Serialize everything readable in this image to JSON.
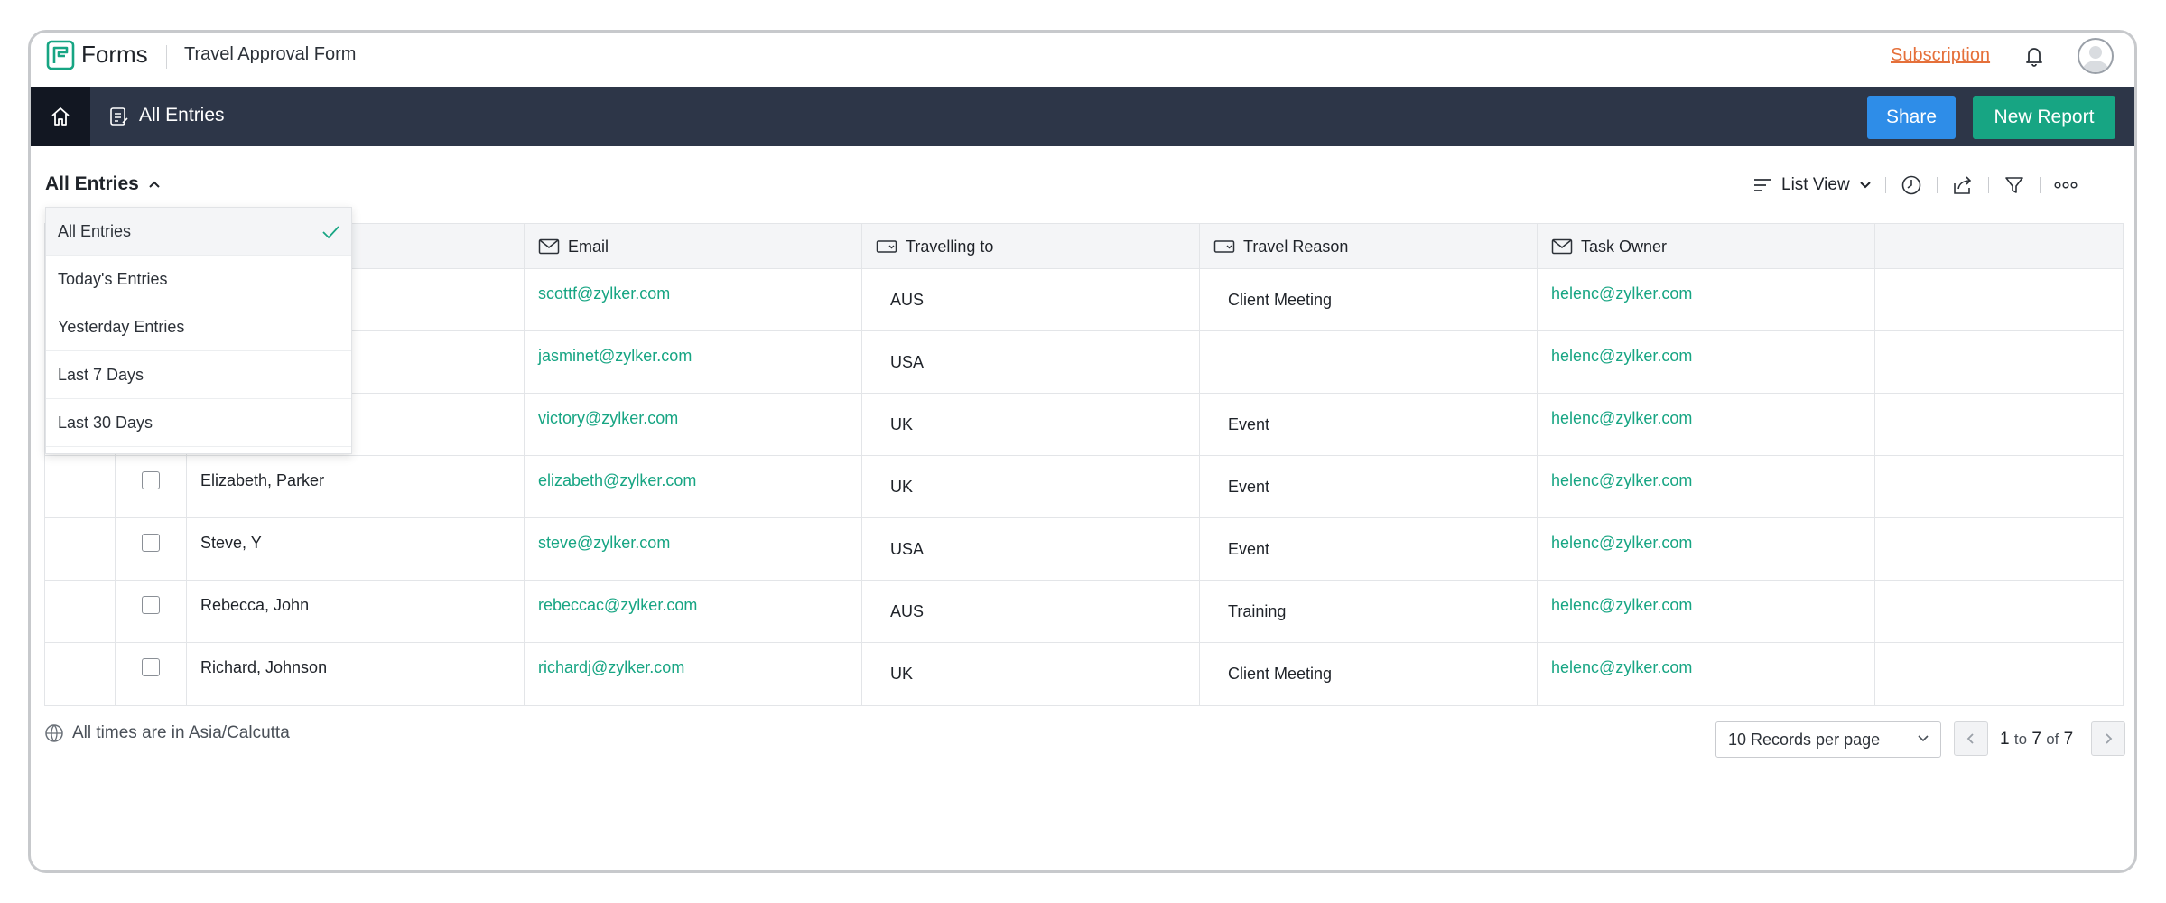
{
  "header": {
    "brand": "Forms",
    "form_title": "Travel Approval Form",
    "subscription_link": "Subscription",
    "icons": [
      "forms-logo-icon",
      "bell-icon",
      "avatar"
    ]
  },
  "navbar": {
    "title": "All Entries",
    "share_label": "Share",
    "new_report_label": "New Report"
  },
  "toolbar": {
    "view_title": "All Entries",
    "view_mode": "List View"
  },
  "dropdown": {
    "items": [
      {
        "label": "All Entries",
        "selected": true
      },
      {
        "label": "Today's Entries"
      },
      {
        "label": "Yesterday Entries"
      },
      {
        "label": "Last 7 Days"
      },
      {
        "label": "Last 30 Days"
      }
    ]
  },
  "table": {
    "columns": [
      "Email",
      "Travelling to",
      "Travel Reason",
      "Task Owner"
    ],
    "rows": [
      {
        "name": "",
        "email": "scottf@zylker.com",
        "to": "AUS",
        "reason": "Client Meeting",
        "owner": "helenc@zylker.com"
      },
      {
        "name": "",
        "email": "jasminet@zylker.com",
        "to": "USA",
        "reason": "",
        "owner": "helenc@zylker.com"
      },
      {
        "name": "",
        "email": "victory@zylker.com",
        "to": "UK",
        "reason": "Event",
        "owner": "helenc@zylker.com"
      },
      {
        "name": "Elizabeth, Parker",
        "email": "elizabeth@zylker.com",
        "to": "UK",
        "reason": "Event",
        "owner": "helenc@zylker.com"
      },
      {
        "name": "Steve, Y",
        "email": "steve@zylker.com",
        "to": "USA",
        "reason": "Event",
        "owner": "helenc@zylker.com"
      },
      {
        "name": "Rebecca, John",
        "email": "rebeccac@zylker.com",
        "to": "AUS",
        "reason": "Training",
        "owner": "helenc@zylker.com"
      },
      {
        "name": "Richard, Johnson",
        "email": "richardj@zylker.com",
        "to": "UK",
        "reason": "Client Meeting",
        "owner": "helenc@zylker.com"
      }
    ]
  },
  "footer": {
    "timezone_text": "All times are in Asia/Calcutta",
    "per_page": "10 Records per page",
    "page_from": "1",
    "page_to_word": "to",
    "page_to": "7",
    "page_of_word": "of",
    "page_total": "7"
  },
  "colors": {
    "navbar": "#2d3648",
    "share": "#2e8de8",
    "new_report": "#17a583",
    "link": "#17a583",
    "subscription": "#e5703a"
  }
}
